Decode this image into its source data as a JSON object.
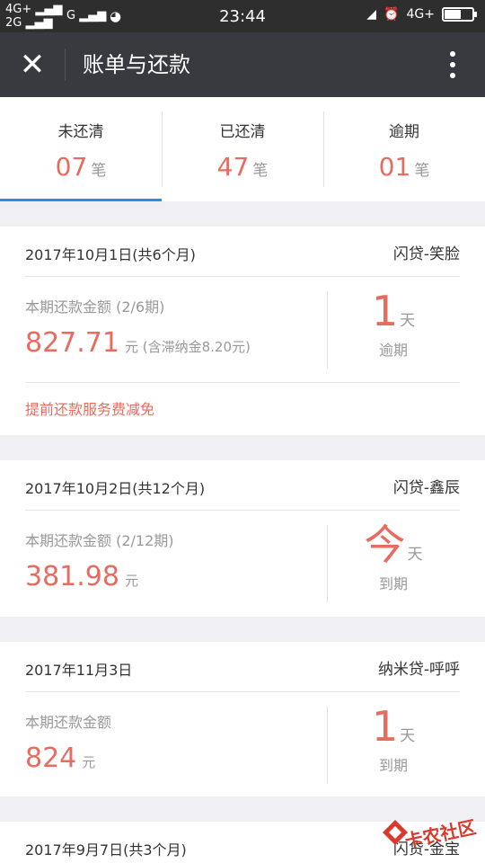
{
  "status_bar": {
    "network_left_top": "4G+",
    "network_left_bottom": "2G",
    "network_g": "G",
    "time": "23:44",
    "network_right": "4G+"
  },
  "app_bar": {
    "title": "账单与还款"
  },
  "tabs": [
    {
      "label": "未还清",
      "count": "07",
      "unit": "笔"
    },
    {
      "label": "已还清",
      "count": "47",
      "unit": "笔"
    },
    {
      "label": "逾期",
      "count": "01",
      "unit": "笔"
    }
  ],
  "bills": [
    {
      "date": "2017年10月1日(共6个月)",
      "product": "闪贷-笑脸",
      "period_label": "本期还款金额 (2/6期)",
      "amount": "827.71",
      "amount_suffix": "元 (含滞纳金8.20元)",
      "due_value": "1",
      "due_unit": "天",
      "due_label": "逾期",
      "promo": "提前还款服务费减免"
    },
    {
      "date": "2017年10月2日(共12个月)",
      "product": "闪贷-鑫辰",
      "period_label": "本期还款金额 (2/12期)",
      "amount": "381.98",
      "amount_suffix": "元",
      "due_value": "今",
      "due_unit": "天",
      "due_label": "到期"
    },
    {
      "date": "2017年11月3日",
      "product": "纳米贷-呼呼",
      "period_label": "本期还款金额",
      "amount": "824",
      "amount_suffix": "元",
      "due_value": "1",
      "due_unit": "天",
      "due_label": "到期"
    },
    {
      "date": "2017年9月7日(共3个月)",
      "product": "闪贷-金宝"
    }
  ],
  "watermark": {
    "text": "卡农社区"
  },
  "colors": {
    "accent_red": "#e86b5f",
    "tab_underline": "#2f8de4",
    "app_bar_bg": "#393a3f"
  }
}
